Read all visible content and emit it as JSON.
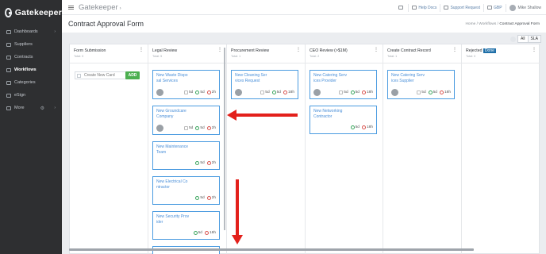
{
  "brand": {
    "name": "Gatekeeper"
  },
  "sidebar": {
    "items": [
      {
        "label": "Dashboards",
        "chevron": "›"
      },
      {
        "label": "Suppliers"
      },
      {
        "label": "Contracts"
      },
      {
        "label": "Workflows",
        "active": true
      },
      {
        "label": "Categories"
      },
      {
        "label": "eSign"
      },
      {
        "label": "More",
        "chevron": "›"
      }
    ]
  },
  "topbar": {
    "app_title": "Gatekeeper",
    "caret": "›",
    "help": "Help Docs",
    "support": "Support Request",
    "currency": "GBP",
    "user": "Mike Shallow"
  },
  "page": {
    "title": "Contract Approval Form",
    "breadcrumb": {
      "home": "Home",
      "sep": "/",
      "section": "Workflows",
      "current": "Contract Approval Form"
    }
  },
  "filters": {
    "all": "All",
    "sla": "SLA"
  },
  "columns": [
    {
      "title": "Form Submission",
      "sub": "Total: 0",
      "menu": "⋮"
    },
    {
      "title": "Legal Review",
      "sub": "Total: 5",
      "menu": "⋮"
    },
    {
      "title": "Procurement Review",
      "sub": "Total: 1",
      "menu": "⋮"
    },
    {
      "title": "CEO Review (>$1M)",
      "sub": "Total: 2",
      "menu": "⋮"
    },
    {
      "title": "Create Contract Record",
      "sub": "Total: 1",
      "menu": "⋮"
    },
    {
      "title": "Rejected",
      "badge": "Done",
      "sub": "Total: 0",
      "menu": "⋮"
    }
  ],
  "new_card": {
    "placeholder": "Create New Card",
    "add_label": "ADD"
  },
  "cards": {
    "legal": [
      {
        "line1": "New Waste Dispo",
        "line2": "sal Services",
        "box": "5d",
        "check": "5d",
        "clock": "2h"
      },
      {
        "line1": "New Groundcare",
        "line2": "Company",
        "box": "5d",
        "check": "5d",
        "clock": "2h"
      },
      {
        "line1": "New Maintenance",
        "line2": "Team",
        "check": "5d",
        "clock": "2h"
      },
      {
        "line1": "New Electrical Co",
        "line2": "ntractor",
        "check": "5d",
        "clock": "2h"
      },
      {
        "line1": "New Security Prov",
        "line2": "ider",
        "check": "5d",
        "clock": "18h"
      }
    ],
    "procurement": [
      {
        "line1": "New Cleaning Ser",
        "line2": "vices Request",
        "box": "5d",
        "check": "5d",
        "clock": "18h"
      }
    ],
    "ceo": [
      {
        "line1": "New Catering Serv",
        "line2": "ices Provider",
        "box": "5d",
        "check": "5d",
        "clock": "18h"
      },
      {
        "line1": "New Networking",
        "line2": "Contractor",
        "check": "5d",
        "clock": "18h"
      }
    ],
    "create": [
      {
        "line1": "New Catering Serv",
        "line2": "ices Supplier",
        "box": "5d",
        "check": "5d",
        "clock": "18h"
      }
    ]
  },
  "colors": {
    "accent": "#4a9be0",
    "arrow": "#e3201b",
    "add": "#4caf50",
    "done": "#1f6fa8"
  }
}
